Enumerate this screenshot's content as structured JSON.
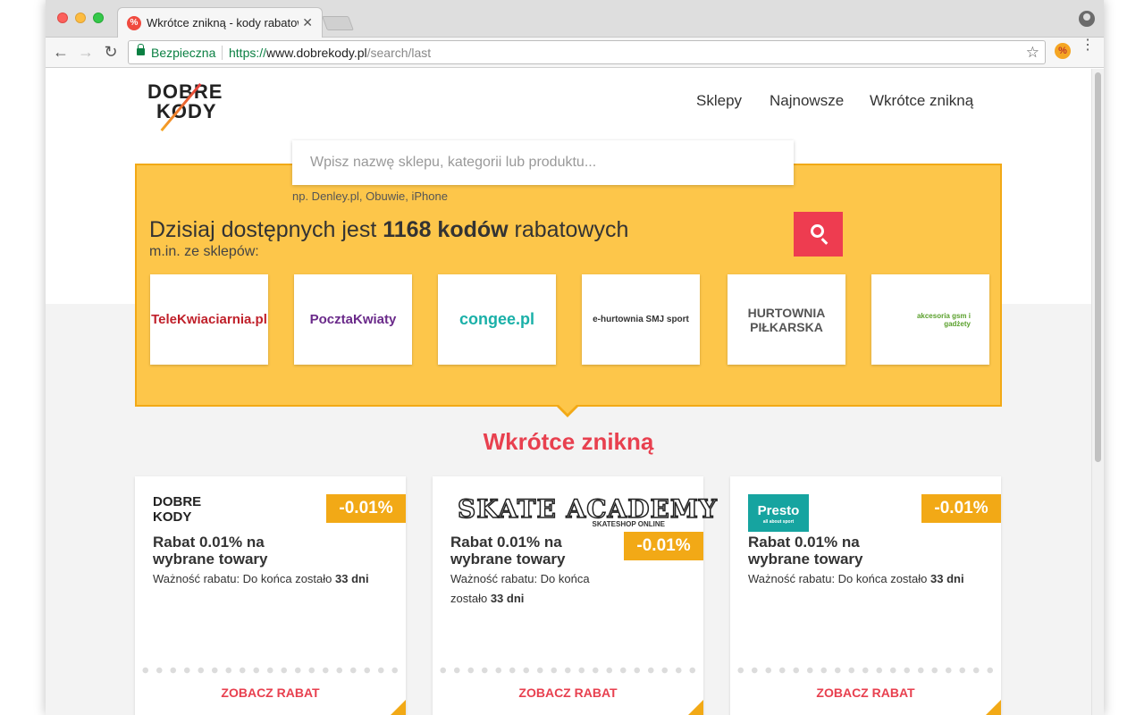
{
  "browser": {
    "tab_title": "Wkrótce znikną - kody rabatowe",
    "tab_favicon": "%",
    "tab_close": "✕",
    "secure_label": "Bezpieczna",
    "url_scheme": "https://",
    "url_host": "www.dobrekody.pl",
    "url_path": "/search/last",
    "back": "←",
    "forward": "→",
    "reload": "↻",
    "star": "☆",
    "ext_icon": "%",
    "menu": "⋮"
  },
  "logo": {
    "line1": "DOBRE",
    "line2": "KODY"
  },
  "nav": {
    "sklepy": "Sklepy",
    "najnowsze": "Najnowsze",
    "wkrotce": "Wkrótce znikną"
  },
  "search": {
    "placeholder": "Wpisz nazwę sklepu, kategorii lub produktu...",
    "hint": "np. Denley.pl, Obuwie, iPhone"
  },
  "hero": {
    "headline_pre": "Dzisiaj dostępnych jest ",
    "headline_bold": "1168 kodów",
    "headline_post": " rabatowych",
    "subhead": "m.in. ze sklepów:"
  },
  "stores": [
    {
      "name": "TeleKwiaciarnia.pl",
      "color": "#c0202a"
    },
    {
      "name": "PocztaKwiaty",
      "color": "#6a2a8a"
    },
    {
      "name": "congee.pl",
      "color": "#1ab0a8"
    },
    {
      "name": "e-hurtownia SMJ sport",
      "color": "#333333"
    },
    {
      "name": "HURTOWNIA PIŁKARSKA",
      "color": "#555555"
    },
    {
      "name": "akcesoria gsm i gadżety",
      "color": "#5aa02c"
    }
  ],
  "section": {
    "title": "Wkrótce znikną"
  },
  "coupons": [
    {
      "store": "DOBRE KODY",
      "badge": "-0.01%",
      "title": "Rabat 0.01% na wybrane towary",
      "validity_pre": "Ważność rabatu: Do końca zostało ",
      "validity_days": "33 dni",
      "cta": "ZOBACZ RABAT"
    },
    {
      "store": "SKATE ACADEMY",
      "store_sub": "SKATESHOP ONLINE",
      "badge": "-0.01%",
      "title": "Rabat 0.01% na wybrane towary",
      "validity_pre": "Ważność rabatu: Do końca zostało ",
      "validity_days": "33 dni",
      "cta": "ZOBACZ RABAT"
    },
    {
      "store": "Presto",
      "store_sub": "all about sport",
      "badge": "-0.01%",
      "title": "Rabat 0.01% na wybrane towary",
      "validity_pre": "Ważność rabatu: Do końca zostało ",
      "validity_days": "33 dni",
      "cta": "ZOBACZ RABAT"
    }
  ],
  "colors": {
    "accent_red": "#ee3c50",
    "hero_yellow": "#fdc64a",
    "badge_orange": "#f2a916",
    "presto_teal": "#16a4a0"
  }
}
